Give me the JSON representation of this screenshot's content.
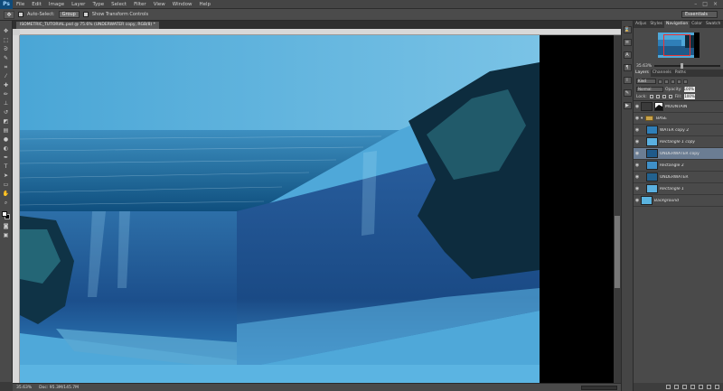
{
  "app": {
    "logo": "Ps"
  },
  "menu": [
    "File",
    "Edit",
    "Image",
    "Layer",
    "Type",
    "Select",
    "Filter",
    "View",
    "Window",
    "Help"
  ],
  "window_controls": [
    "–",
    "□",
    "×"
  ],
  "options_bar": {
    "auto_select_label": "Auto-Select:",
    "auto_select_value": "Group",
    "transform_label": "Show Transform Controls",
    "workspace": "Essentials"
  },
  "document": {
    "tab_title": "ISOMETRIC_TUTORIAL.psd @ 75.6% (UNDERWATER copy, RGB/8) *",
    "zoom": "35.63%",
    "doc_size": "Doc: 95.3M/145.7M"
  },
  "panels": {
    "top_tabs": [
      "Adjus",
      "Styles",
      "Navigation",
      "Color",
      "Swatch"
    ],
    "top_active": "Navigation",
    "nav_zoom": "35.63%",
    "layer_tabs": [
      "Layers",
      "Channels",
      "Paths"
    ],
    "layer_active": "Layers",
    "kind": "Kind",
    "blend_mode": "Normal",
    "opacity_label": "Opacity:",
    "opacity": "100%",
    "lock_label": "Lock:",
    "fill_label": "Fill:",
    "fill": "100%"
  },
  "layers": [
    {
      "name": "MOUNTAIN",
      "type": "mask",
      "color": "#3a3a3a",
      "selected": false,
      "italic": false
    },
    {
      "name": "BASE",
      "type": "group",
      "color": "",
      "selected": false,
      "italic": false
    },
    {
      "name": "WATER copy 2",
      "type": "image",
      "color": "#2f7fb8",
      "selected": false,
      "italic": false
    },
    {
      "name": "Rectangle 1 copy",
      "type": "shape",
      "color": "#5ab0e0",
      "selected": false,
      "italic": true
    },
    {
      "name": "UNDERWATER copy",
      "type": "image",
      "color": "#1f5a8a",
      "selected": true,
      "italic": false
    },
    {
      "name": "Rectangle 2",
      "type": "image",
      "color": "#3f90c8",
      "selected": false,
      "italic": false
    },
    {
      "name": "UNDERWATER",
      "type": "image",
      "color": "#23628f",
      "selected": false,
      "italic": false
    },
    {
      "name": "Rectangle 1",
      "type": "shape",
      "color": "#5ab0e0",
      "selected": false,
      "italic": true
    },
    {
      "name": "Background",
      "type": "image",
      "color": "#5ab3df",
      "selected": false,
      "italic": true
    }
  ]
}
